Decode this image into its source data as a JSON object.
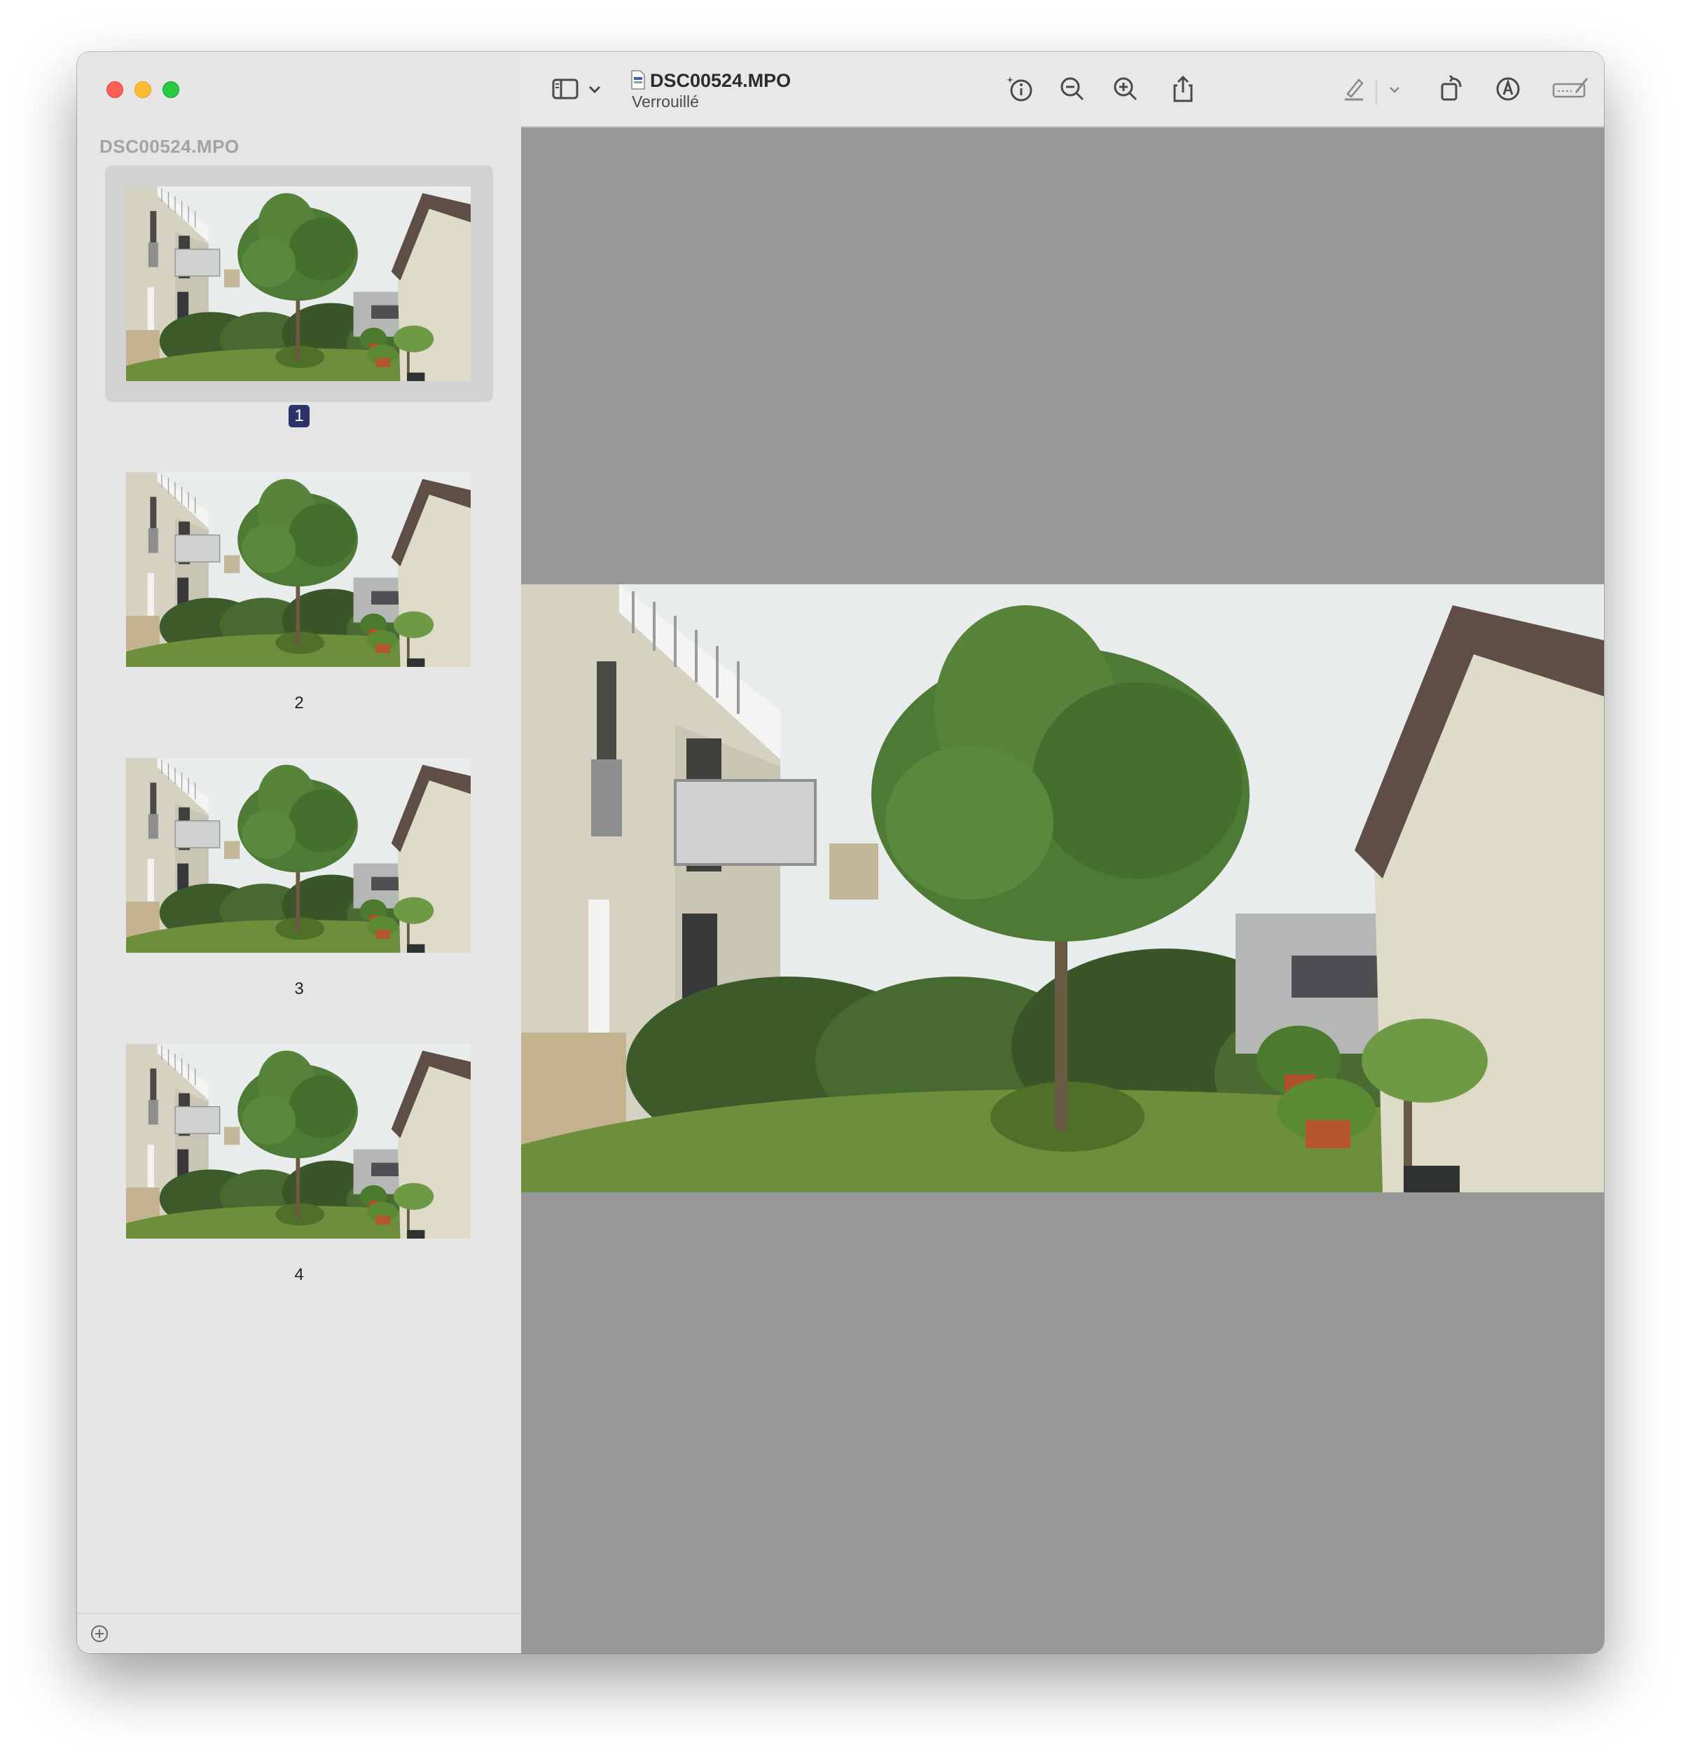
{
  "window": {
    "controls": {
      "close": "red-close-icon",
      "minimize": "yellow-minimize-icon",
      "zoom": "green-zoom-icon"
    }
  },
  "sidebar": {
    "title": "DSC00524.MPO",
    "pages": [
      {
        "label": "1",
        "selected": true
      },
      {
        "label": "2",
        "selected": false
      },
      {
        "label": "3",
        "selected": false
      },
      {
        "label": "4",
        "selected": false
      }
    ]
  },
  "toolbar": {
    "doc_title": "DSC00524.MPO",
    "doc_status": "Verrouillé",
    "icons": [
      "sidebar-toggle-icon",
      "chevron-down-icon",
      "info-icon",
      "zoom-out-icon",
      "zoom-in-icon",
      "share-icon",
      "highlight-icon",
      "chevron-down-icon",
      "rotate-icon",
      "markup-icon",
      "form-fill-icon",
      "search-icon"
    ]
  },
  "colors": {
    "canvas": "#979797",
    "sidebar": "#e5e5e5",
    "selected_thumb": "#d2d2d2",
    "page_badge": "#2b3369"
  }
}
